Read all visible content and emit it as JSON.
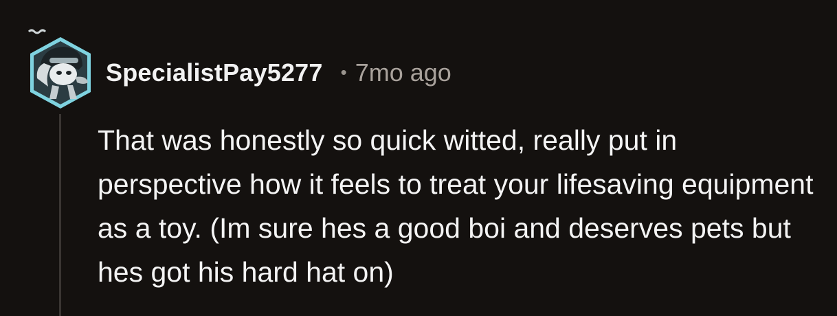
{
  "comment": {
    "username": "SpecialistPay5277",
    "separator": "•",
    "timestamp": "7mo ago",
    "body": "That was honestly so quick witted, really put in perspective how it feels to treat your lifesaving equipment as a toy. (Im sure hes a good boi and deserves pets but hes got his hard hat on)"
  },
  "avatar": {
    "icon": "user-avatar-hexagon",
    "frame_color": "#7fd3e0",
    "inner_color": "#2b3c42"
  },
  "colors": {
    "background": "#14110f",
    "text": "#f4f4f4",
    "muted": "#a9a29c",
    "thread_line": "#3a3633"
  }
}
